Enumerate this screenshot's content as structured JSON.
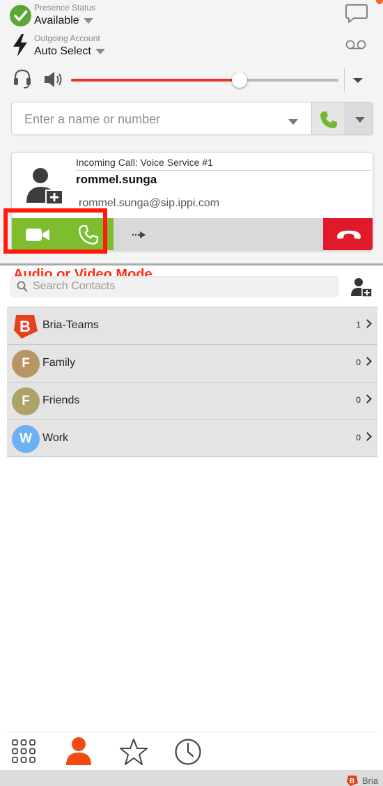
{
  "presence": {
    "label": "Presence Status",
    "value": "Available"
  },
  "outgoing": {
    "label": "Outgoing Account",
    "value": "Auto Select"
  },
  "volume": {
    "level_percent": 63
  },
  "dialer": {
    "placeholder": "Enter a name or number"
  },
  "incoming_call": {
    "header": "Incoming Call: Voice Service #1",
    "caller_name": "rommel.sunga",
    "caller_address": "rommel.sunga@sip.ippi.com"
  },
  "annotation": {
    "text": "Audio or Video Mode"
  },
  "contacts": {
    "search_placeholder": "Search Contacts",
    "groups": [
      {
        "initial": "B",
        "name": "Bria-Teams",
        "count": "1",
        "color": "#e8401c"
      },
      {
        "initial": "F",
        "name": "Family",
        "count": "0",
        "color": "#b79565"
      },
      {
        "initial": "F",
        "name": "Friends",
        "count": "0",
        "color": "#aea367"
      },
      {
        "initial": "W",
        "name": "Work",
        "count": "0",
        "color": "#6cb2f2"
      }
    ]
  },
  "footer": {
    "brand": "Bria"
  },
  "colors": {
    "accent_orange": "#f26a21",
    "call_green": "#7dbe2e",
    "hangup_red": "#e01a2b",
    "annotation_red": "#ff1a0a",
    "presence_green": "#5aa833"
  },
  "icons": {
    "presence": "check-circle-icon",
    "outgoing": "lightning-icon",
    "chat": "chat-bubble-icon",
    "voicemail": "voicemail-icon",
    "headset": "headset-icon",
    "speaker": "speaker-icon",
    "call": "phone-icon",
    "video": "video-camera-icon",
    "transfer": "transfer-arrow-icon",
    "hangup": "hang-up-icon",
    "add_contact": "add-contact-icon",
    "search": "search-icon",
    "dialpad": "dialpad-icon",
    "contacts": "contacts-icon",
    "favorites": "star-icon",
    "history": "clock-icon"
  }
}
